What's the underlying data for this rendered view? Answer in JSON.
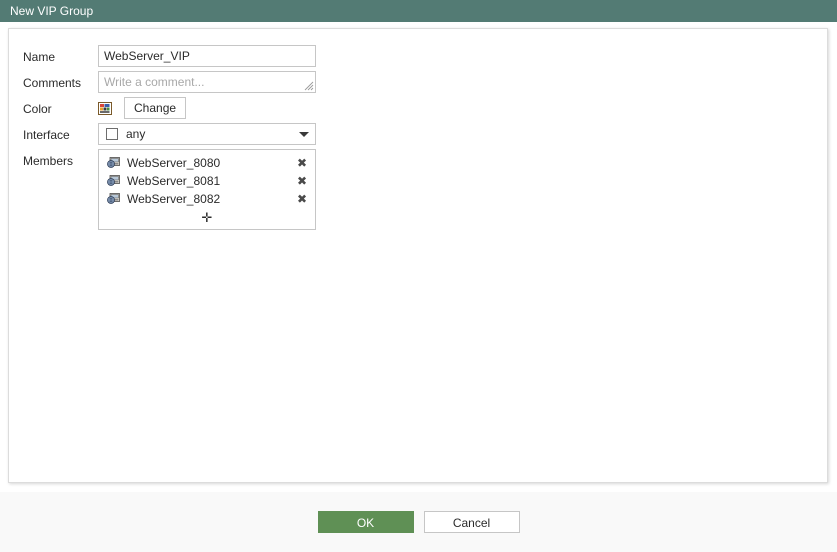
{
  "titlebar": {
    "title": "New VIP Group"
  },
  "form": {
    "name": {
      "label": "Name",
      "value": "WebServer_VIP"
    },
    "comments": {
      "label": "Comments",
      "value": "",
      "placeholder": "Write a comment..."
    },
    "color": {
      "label": "Color",
      "swatch_icon": "color-palette-icon",
      "change_label": "Change"
    },
    "interface": {
      "label": "Interface",
      "value": "any",
      "checked": false,
      "caret_icon": "chevron-down-icon"
    },
    "members": {
      "label": "Members",
      "items": [
        {
          "icon": "vip-server-icon",
          "name": "WebServer_8080",
          "remove_icon": "✖"
        },
        {
          "icon": "vip-server-icon",
          "name": "WebServer_8081",
          "remove_icon": "✖"
        },
        {
          "icon": "vip-server-icon",
          "name": "WebServer_8082",
          "remove_icon": "✖"
        }
      ],
      "add_icon": "✛"
    }
  },
  "footer": {
    "ok_label": "OK",
    "cancel_label": "Cancel"
  },
  "colors": {
    "titlebar_bg": "#537b74",
    "ok_button_bg": "#5f9055",
    "footer_bg": "#f9f9f9",
    "border": "#c6c6c6"
  }
}
